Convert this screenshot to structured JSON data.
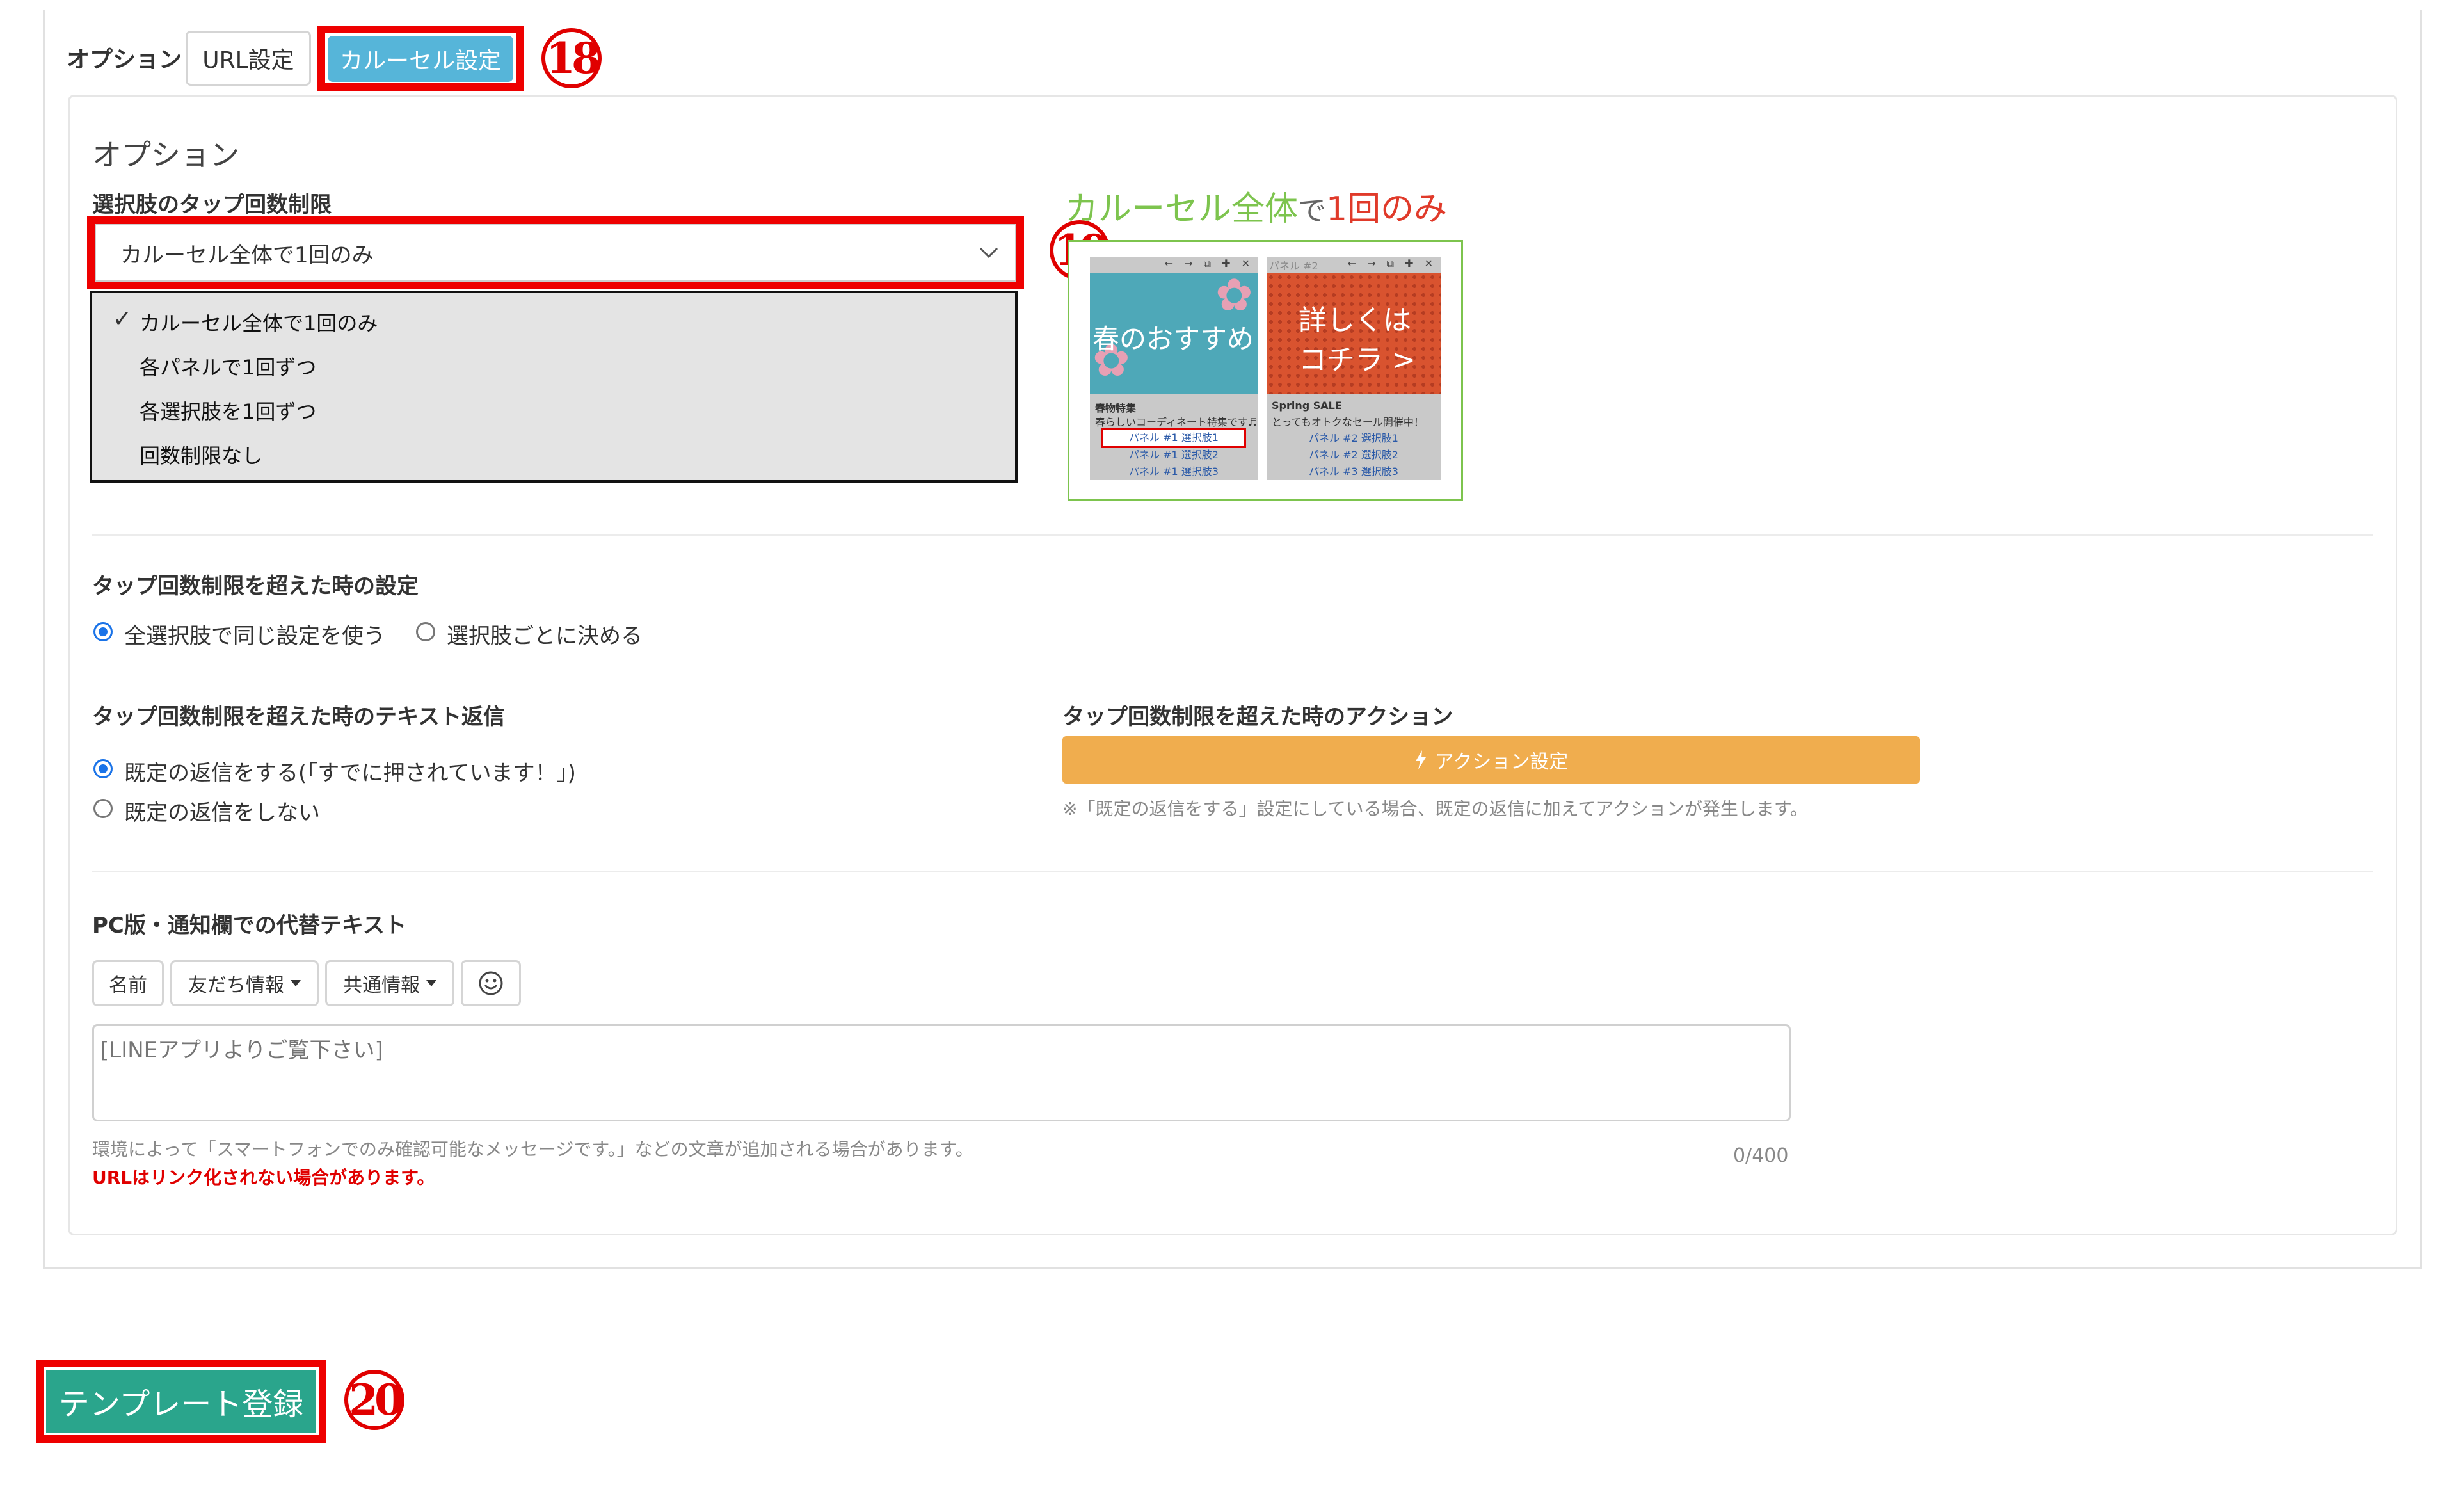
{
  "options_bar": {
    "label": "オプション",
    "tab_url": "URL設定",
    "tab_carousel": "カルーセル設定",
    "marker": "18"
  },
  "section_title": "オプション",
  "tap_limit": {
    "label": "選択肢のタップ回数制限",
    "selected": "カルーセル全体で1回のみ",
    "marker": "19",
    "options": [
      {
        "label": "カルーセル全体で1回のみ",
        "checked": true
      },
      {
        "label": "各パネルで1回ずつ",
        "checked": false
      },
      {
        "label": "各選択肢を1回ずつ",
        "checked": false
      },
      {
        "label": "回数制限なし",
        "checked": false
      }
    ],
    "check_mark": "✓"
  },
  "preview": {
    "caption_part1": "カルーセル全体",
    "caption_part2": "で",
    "caption_part3": "1回のみ",
    "panel1": {
      "image_text": "春のおすすめ",
      "title": "春物特集",
      "desc": "春らしいコーディネート特集です♬",
      "choices": [
        "パネル #1 選択肢1",
        "パネル #1 選択肢2",
        "パネル #1 選択肢3"
      ]
    },
    "panel2": {
      "header": "パネル #2",
      "image_text_line1": "詳しくは",
      "image_text_line2": "コチラ >",
      "title": "Spring SALE",
      "desc": "とってもオトクなセール開催中！",
      "choices": [
        "パネル #2 選択肢1",
        "パネル #2 選択肢2",
        "パネル #3 選択肢3"
      ]
    },
    "toolbar_glyphs": "← → ⧉ ✚ ✕"
  },
  "exceed_setting": {
    "label": "タップ回数制限を超えた時の設定",
    "option_all": "全選択肢で同じ設定を使う",
    "option_each": "選択肢ごとに決める",
    "selected": "all"
  },
  "exceed_text": {
    "label": "タップ回数制限を超えた時のテキスト返信",
    "option_default": "既定の返信をする(「すでに押されています！」)",
    "option_none": "既定の返信をしない",
    "selected": "default"
  },
  "exceed_action": {
    "label": "タップ回数制限を超えた時のアクション",
    "button": "アクション設定",
    "note": "※「既定の返信をする」設定にしている場合、既定の返信に加えてアクションが発生します。"
  },
  "alt_text": {
    "label": "PC版・通知欄での代替テキスト",
    "btn_name": "名前",
    "btn_friend": "友だち情報",
    "btn_common": "共通情報",
    "placeholder": "[LINEアプリよりご覧下さい]",
    "counter": "0/400",
    "help": "環境によって「スマートフォンでのみ確認可能なメッセージです。」などの文章が追加される場合があります。",
    "warning": "URLはリンク化されない場合があります。"
  },
  "submit": {
    "label": "テンプレート登録",
    "marker": "20"
  },
  "colors": {
    "accent_blue": "#56b5d9",
    "highlight_red": "#ee0000",
    "action_orange": "#f0ad4e",
    "submit_green": "#2aa58c",
    "preview_green": "#7dc44e"
  }
}
